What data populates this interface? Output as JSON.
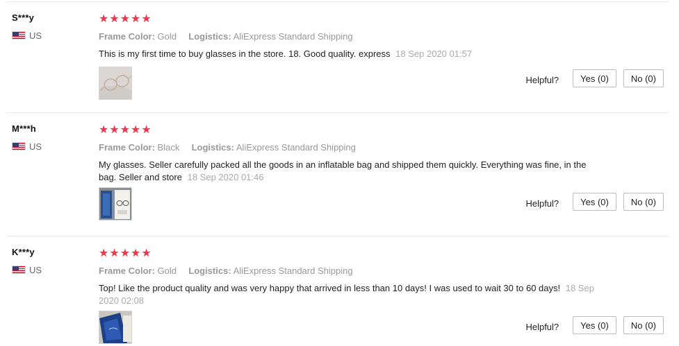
{
  "colors": {
    "star": "#f5354a",
    "muted": "#999999",
    "date": "#aaaaaa"
  },
  "reviews": [
    {
      "user": "S***y",
      "country": "US",
      "flag_icon": "us-flag-icon",
      "rating": 5,
      "stars": "★★★★★",
      "frame_color_label": "Frame Color:",
      "frame_color": "Gold",
      "logistics_label": "Logistics:",
      "logistics": "AliExpress Standard Shipping",
      "text": "This is my first time to buy glasses in the store. 18. Good quality. express",
      "date": "18 Sep 2020 01:57",
      "helpful_label": "Helpful?",
      "yes_label": "Yes (0)",
      "no_label": "No (0)"
    },
    {
      "user": "M***h",
      "country": "US",
      "flag_icon": "us-flag-icon",
      "rating": 5,
      "stars": "★★★★★",
      "frame_color_label": "Frame Color:",
      "frame_color": "Black",
      "logistics_label": "Logistics:",
      "logistics": "AliExpress Standard Shipping",
      "text": "My glasses. Seller carefully packed all the goods in an inflatable bag and shipped them quickly. Everything was fine, in the bag. Seller and store",
      "date": "18 Sep 2020 01:46",
      "helpful_label": "Helpful?",
      "yes_label": "Yes (0)",
      "no_label": "No (0)"
    },
    {
      "user": "K***y",
      "country": "US",
      "flag_icon": "us-flag-icon",
      "rating": 5,
      "stars": "★★★★★",
      "frame_color_label": "Frame Color:",
      "frame_color": "Gold",
      "logistics_label": "Logistics:",
      "logistics": "AliExpress Standard Shipping",
      "text": "Top! Like the product quality and was very happy that arrived in less than 10 days! I was used to wait 30 to 60 days!",
      "date": "18 Sep 2020 02:08",
      "helpful_label": "Helpful?",
      "yes_label": "Yes (0)",
      "no_label": "No (0)"
    }
  ]
}
